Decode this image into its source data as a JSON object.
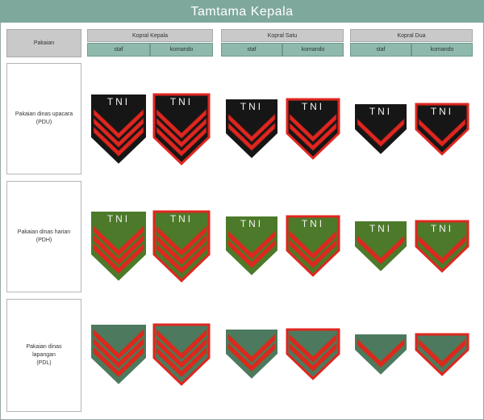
{
  "title": "Tamtama Kepala",
  "header": {
    "pakaian": "Pakaian",
    "ranks": [
      {
        "label": "Kopral Kepala",
        "sub": [
          "staf",
          "komando"
        ]
      },
      {
        "label": "Kopral Satu",
        "sub": [
          "staf",
          "komando"
        ]
      },
      {
        "label": "Kopral Dua",
        "sub": [
          "staf",
          "komando"
        ]
      }
    ]
  },
  "rows": [
    {
      "line1": "Pakaian dinas upacara",
      "line2": "(PDU)",
      "line3": ""
    },
    {
      "line1": "Pakaian dinas harian",
      "line2": "(PDH)",
      "line3": ""
    },
    {
      "line1": "Pakaian dinas",
      "line2": "lapangan",
      "line3": "(PDL)"
    }
  ],
  "badge_text": "TNI",
  "colors": {
    "title_bar": "#7fa89c",
    "pdu_background": "#161616",
    "pdh_background": "#4c7a2a",
    "pdl_background": "#4d7a5e",
    "chevron_red": "#e0261f",
    "komando_border": "#e0261f"
  }
}
